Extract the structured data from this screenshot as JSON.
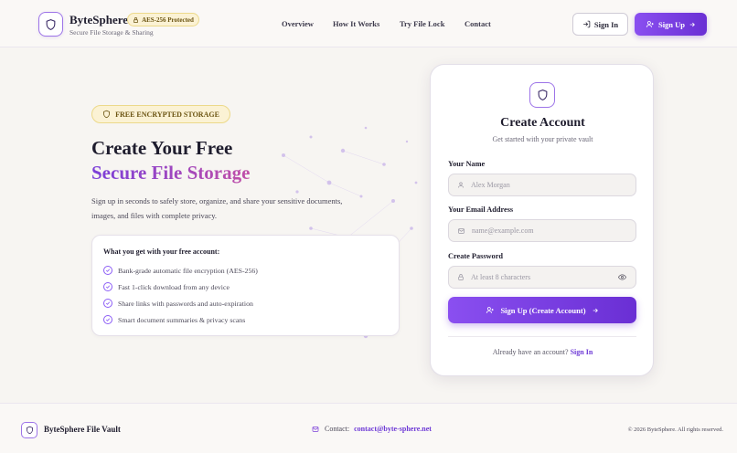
{
  "header": {
    "brand_name": "ByteSphere",
    "brand_tagline": "Secure File Storage & Sharing",
    "badge": "AES-256 Protected",
    "nav": [
      "Overview",
      "How It Works",
      "Try File Lock",
      "Contact"
    ],
    "signin_label": "Sign In",
    "signup_label": "Sign Up"
  },
  "hero": {
    "badge": "FREE ENCRYPTED STORAGE",
    "title_line1": "Create Your Free",
    "title_line2": "Secure File Storage",
    "description": "Sign up in seconds to safely store, organize, and share your sensitive documents, images, and files with complete privacy.",
    "benefits_title": "What you get with your free account:",
    "benefits": [
      "Bank-grade automatic file encryption (AES-256)",
      "Fast 1-click download from any device",
      "Share links with passwords and auto-expiration",
      "Smart document summaries & privacy scans"
    ]
  },
  "form": {
    "title": "Create Account",
    "subtitle": "Get started with your private vault",
    "name_label": "Your Name",
    "name_placeholder": "Alex Morgan",
    "email_label": "Your Email Address",
    "email_placeholder": "name@example.com",
    "password_label": "Create Password",
    "password_placeholder": "At least 8 characters",
    "submit_label": "Sign Up (Create Account)",
    "footer_text": "Already have an account?",
    "footer_link": "Sign In"
  },
  "footer": {
    "brand": "ByteSphere File Vault",
    "contact_label": "Contact:",
    "contact_email": "contact@byte-sphere.net",
    "copyright": "© 2026 ByteSphere. All rights reserved."
  },
  "colors": {
    "accent": "#7b3fd9",
    "badge_bg": "#fbf2d4",
    "background": "#f7f5f2"
  },
  "icons": {
    "logo": "shield-icon",
    "badge": "lock-icon",
    "signin": "login-icon",
    "signup": "user-plus-icon",
    "arrow": "arrow-right-icon",
    "check": "check-circle-icon",
    "name": "user-icon",
    "email": "mail-icon",
    "password": "lock-icon",
    "toggle": "eye-icon"
  }
}
